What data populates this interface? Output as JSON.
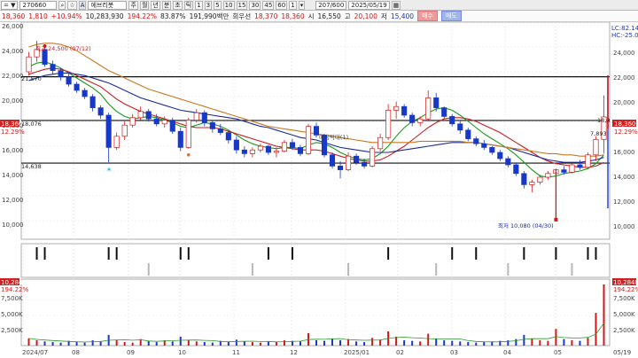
{
  "toolbar": {
    "prefix": "= ▼",
    "code": "270660",
    "search_icon": "magnifier-icon",
    "fav_icon": "star-icon",
    "name_prefix": "A",
    "name": "에브리봇",
    "periods": [
      "주",
      "월",
      "년",
      "분",
      "초",
      "틱"
    ],
    "intervals": [
      "1",
      "3",
      "5",
      "10",
      "15",
      "30",
      "45",
      "60",
      "1"
    ],
    "count": "207/600",
    "date": "2025/05/19"
  },
  "info": {
    "price": "18,360",
    "change": "1,810",
    "change_pct": "+10.94%",
    "volume": "10,283,930",
    "vol_pct": "194.22%",
    "turnover": "83.87%",
    "amount": "191,990백만",
    "prev_label": "회우선",
    "prev_value": "18,370",
    "bid": "18,360",
    "open_label": "시",
    "open": "16,550",
    "high_label": "고",
    "high": "20,100",
    "low_label": "저",
    "low": "15,400",
    "buy_label": "매수",
    "sell_label": "매도"
  },
  "chart": {
    "left_labels": {
      "price_top": "18,360",
      "vol_top": "10,284K"
    },
    "ytick_labels": [
      "26,000",
      "24,000",
      "22,000",
      "20,000",
      "18,000",
      "16,000",
      "14,000",
      "12,000",
      "10,000"
    ],
    "right_ytick_labels": [
      "24,000",
      "22,000",
      "20,000",
      "18,000",
      "16,000",
      "14,000",
      "12,000",
      "10,000"
    ],
    "right_top": [
      "LC:82.14",
      "HC:-25.06"
    ],
    "right_price_tag": "18,360",
    "right_price_pct": "12.29%",
    "hlines": [
      {
        "value": 21600,
        "label": ""
      },
      {
        "value": 18076,
        "label": "18,076"
      },
      {
        "value": 14638,
        "label": "14,638"
      }
    ],
    "hline_left_label_top": "21,570",
    "annotations": {
      "high": "최고 24,500 (07/12)",
      "low": "최저 10,080 (04/30)",
      "mid": "매칭막대(1)",
      "right_a": "18,3",
      "right_b": "7,893"
    },
    "vol_left_labels": [
      "194.22%",
      "7,500K",
      "5,000K",
      "2,500K"
    ],
    "vol_right_labels": [
      "10,284K",
      "194.22%",
      "7,500K",
      "5,000K",
      "2,500K"
    ],
    "xlabels": [
      "2024/07",
      "08",
      "09",
      "10",
      "11",
      "12",
      "2025/01",
      "02",
      "03",
      "04",
      "05",
      "05/19"
    ]
  },
  "chart_data": {
    "type": "candlestick",
    "candles": [
      [
        22000,
        23600,
        21700,
        23200
      ],
      [
        23200,
        24500,
        22800,
        23800
      ],
      [
        23800,
        24000,
        22400,
        22600
      ],
      [
        22600,
        22900,
        21800,
        22100
      ],
      [
        22100,
        22300,
        21300,
        21600
      ],
      [
        21600,
        21900,
        20800,
        21000
      ],
      [
        21000,
        21200,
        20300,
        20500
      ],
      [
        20500,
        20700,
        19800,
        20000
      ],
      [
        20000,
        20200,
        18800,
        19100
      ],
      [
        19100,
        19300,
        18200,
        18500
      ],
      [
        18500,
        18700,
        14700,
        15900
      ],
      [
        15900,
        17100,
        15700,
        16800
      ],
      [
        16800,
        18000,
        16500,
        17700
      ],
      [
        17700,
        18600,
        17500,
        18300
      ],
      [
        18300,
        19200,
        18100,
        18800
      ],
      [
        18800,
        19000,
        18000,
        18200
      ],
      [
        18200,
        18600,
        17600,
        17800
      ],
      [
        17800,
        18400,
        17500,
        18100
      ],
      [
        18100,
        18300,
        17000,
        17200
      ],
      [
        17200,
        17500,
        15600,
        15900
      ],
      [
        15900,
        18300,
        15800,
        18100
      ],
      [
        18100,
        19000,
        17900,
        18700
      ],
      [
        18700,
        18900,
        17600,
        17900
      ],
      [
        17900,
        18100,
        17100,
        17400
      ],
      [
        17400,
        17800,
        16900,
        17100
      ],
      [
        17100,
        17300,
        16200,
        16500
      ],
      [
        16500,
        16800,
        15400,
        15700
      ],
      [
        15700,
        16000,
        15100,
        15400
      ],
      [
        15400,
        15900,
        15100,
        15700
      ],
      [
        15700,
        16200,
        15500,
        16000
      ],
      [
        16000,
        16100,
        15300,
        15500
      ],
      [
        15500,
        15900,
        15100,
        15600
      ],
      [
        15600,
        16500,
        15500,
        16300
      ],
      [
        16300,
        16600,
        15700,
        15900
      ],
      [
        15900,
        16100,
        15200,
        15400
      ],
      [
        15400,
        17800,
        15300,
        17600
      ],
      [
        17600,
        17900,
        16700,
        16900
      ],
      [
        16900,
        17000,
        15100,
        15300
      ],
      [
        15300,
        15500,
        14200,
        14400
      ],
      [
        14400,
        14800,
        13400,
        14100
      ],
      [
        14100,
        15500,
        14000,
        15200
      ],
      [
        15200,
        15400,
        14500,
        14700
      ],
      [
        14700,
        15000,
        14200,
        14400
      ],
      [
        14400,
        16000,
        14300,
        15800
      ],
      [
        15800,
        17000,
        15600,
        16700
      ],
      [
        16700,
        19400,
        16500,
        18900
      ],
      [
        18900,
        19600,
        18200,
        19200
      ],
      [
        19200,
        19400,
        18300,
        18500
      ],
      [
        18500,
        18700,
        17600,
        17900
      ],
      [
        17900,
        18400,
        17600,
        18200
      ],
      [
        18200,
        20500,
        18000,
        19900
      ],
      [
        19900,
        20300,
        18800,
        19100
      ],
      [
        19100,
        19200,
        18200,
        18400
      ],
      [
        18400,
        18600,
        17600,
        17800
      ],
      [
        17800,
        18100,
        17000,
        17300
      ],
      [
        17300,
        17500,
        16400,
        16600
      ],
      [
        16600,
        16800,
        16000,
        16200
      ],
      [
        16200,
        16500,
        15700,
        15900
      ],
      [
        15900,
        16000,
        15300,
        15500
      ],
      [
        15500,
        15700,
        14800,
        15000
      ],
      [
        15000,
        15200,
        14300,
        14500
      ],
      [
        14500,
        14700,
        13600,
        13800
      ],
      [
        13800,
        14000,
        12600,
        12900
      ],
      [
        12900,
        13300,
        12300,
        13100
      ],
      [
        13100,
        13700,
        12900,
        13500
      ],
      [
        13500,
        14000,
        13300,
        13800
      ],
      [
        13800,
        14200,
        10080,
        14100
      ],
      [
        14100,
        14400,
        13700,
        13900
      ],
      [
        13900,
        14600,
        13800,
        14500
      ],
      [
        14500,
        14900,
        14100,
        14300
      ],
      [
        14300,
        15500,
        14200,
        15300
      ],
      [
        15300,
        16800,
        14800,
        16550
      ],
      [
        16550,
        20100,
        15400,
        18360
      ]
    ],
    "ma_series": [
      {
        "color": "#1a9a1a",
        "values": [
          22400,
          22700,
          22800,
          22600,
          22300,
          21900,
          21500,
          21100,
          20700,
          20200,
          19400,
          18800,
          18400,
          18200,
          18300,
          18400,
          18300,
          18100,
          17900,
          17600,
          17500,
          17700,
          17900,
          17800,
          17600,
          17300,
          16900,
          16500,
          16200,
          16000,
          15900,
          15800,
          15900,
          15900,
          15800,
          16100,
          16300,
          16200,
          15900,
          15500,
          15200,
          15000,
          14900,
          15000,
          15400,
          16000,
          16800,
          17500,
          18000,
          18300,
          18700,
          19000,
          19100,
          18900,
          18500,
          18000,
          17500,
          17000,
          16600,
          16200,
          15800,
          15300,
          14700,
          14100,
          13600,
          13500,
          13600,
          13800,
          13900,
          14000,
          14200,
          14600,
          15300
        ]
      },
      {
        "color": "#c81c24",
        "values": [
          21800,
          22000,
          22200,
          22300,
          22200,
          22000,
          21700,
          21400,
          21100,
          20800,
          20300,
          19800,
          19400,
          19100,
          18800,
          18600,
          18400,
          18200,
          18000,
          17800,
          17600,
          17500,
          17500,
          17500,
          17400,
          17200,
          17000,
          16800,
          16600,
          16400,
          16200,
          16000,
          15900,
          15800,
          15700,
          15700,
          15700,
          15600,
          15400,
          15200,
          15000,
          14900,
          14800,
          14800,
          14900,
          15200,
          15600,
          16000,
          16500,
          17000,
          17500,
          17900,
          18200,
          18300,
          18300,
          18200,
          18000,
          17700,
          17400,
          17100,
          16700,
          16300,
          15900,
          15500,
          15100,
          14800,
          14600,
          14500,
          14400,
          14300,
          14300,
          14400,
          14700
        ]
      },
      {
        "color": "#1c2a9c",
        "values": [
          21300,
          21500,
          21700,
          21800,
          21900,
          21900,
          21800,
          21700,
          21500,
          21300,
          21100,
          20800,
          20500,
          20200,
          19900,
          19700,
          19500,
          19300,
          19100,
          18900,
          18800,
          18700,
          18600,
          18500,
          18400,
          18300,
          18200,
          18000,
          17800,
          17600,
          17500,
          17300,
          17100,
          16900,
          16700,
          16600,
          16500,
          16300,
          16100,
          15900,
          15800,
          15700,
          15600,
          15500,
          15500,
          15500,
          15600,
          15700,
          15800,
          15900,
          16000,
          16100,
          16200,
          16300,
          16300,
          16300,
          16300,
          16200,
          16100,
          16000,
          15900,
          15700,
          15500,
          15300,
          15100,
          14900,
          14800,
          14700,
          14700,
          14700,
          14800,
          14900,
          15100
        ]
      },
      {
        "color": "#c87820",
        "values": [
          24000,
          24200,
          24300,
          24300,
          24200,
          24000,
          23700,
          23300,
          22900,
          22500,
          22100,
          21800,
          21500,
          21200,
          20900,
          20600,
          20400,
          20200,
          20000,
          19800,
          19600,
          19400,
          19200,
          19000,
          18800,
          18600,
          18400,
          18200,
          18000,
          17800,
          17600,
          17500,
          17400,
          17300,
          17200,
          17100,
          17000,
          16900,
          16800,
          16700,
          16600,
          16500,
          16400,
          16300,
          16300,
          16300,
          16300,
          16300,
          16300,
          16400,
          16400,
          16400,
          16400,
          16400,
          16400,
          16300,
          16300,
          16200,
          16100,
          16000,
          15900,
          15800,
          15700,
          15600,
          15500,
          15400,
          15400,
          15300,
          15300,
          15200,
          15200,
          15200,
          15300
        ]
      }
    ],
    "volume": [
      1200,
      900,
      700,
      600,
      500,
      800,
      600,
      500,
      900,
      700,
      1800,
      900,
      600,
      500,
      1100,
      800,
      600,
      900,
      700,
      1500,
      900,
      700,
      600,
      500,
      800,
      600,
      1000,
      700,
      600,
      500,
      700,
      600,
      900,
      800,
      700,
      2100,
      900,
      800,
      1200,
      900,
      1100,
      700,
      600,
      1300,
      1000,
      2400,
      1500,
      900,
      800,
      700,
      2000,
      1200,
      900,
      800,
      700,
      600,
      500,
      600,
      700,
      800,
      900,
      1100,
      1800,
      1200,
      900,
      800,
      2800,
      1100,
      900,
      800,
      1300,
      5500,
      10284
    ],
    "signals_up": [
      1,
      2,
      10,
      11,
      19,
      20,
      30,
      33,
      45,
      53,
      56,
      62,
      66,
      70,
      71
    ],
    "signals_down": [
      15,
      28,
      40,
      51,
      60,
      68
    ]
  }
}
